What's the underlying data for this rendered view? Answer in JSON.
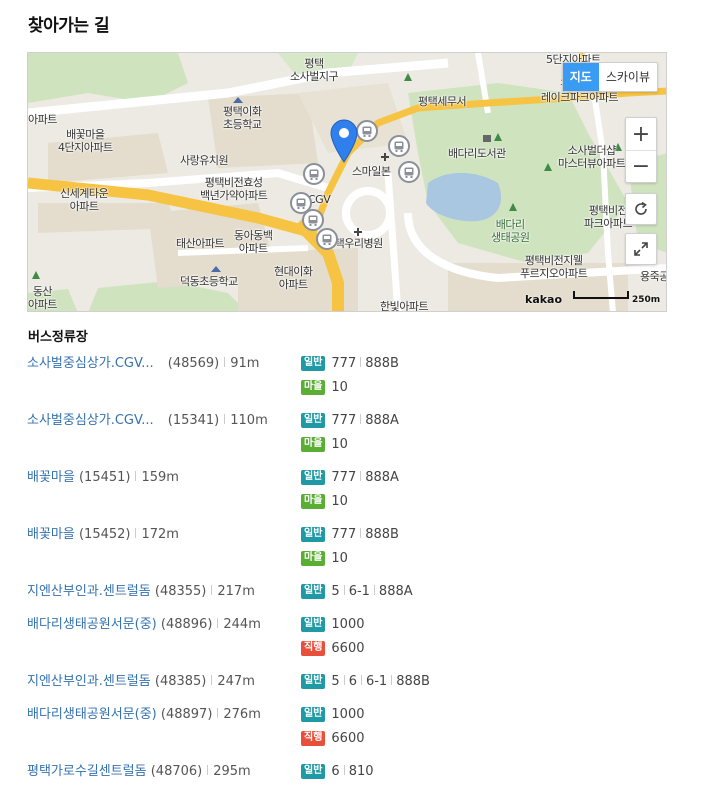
{
  "section_title": "찾아가는 길",
  "map": {
    "type_buttons": {
      "map": "지도",
      "skyview": "스카이뷰"
    },
    "controls": {
      "zoom_in": "+",
      "zoom_out": "−"
    },
    "brand": "kakao",
    "scale": "250m",
    "labels": {
      "police": "평택\n소사벌지구",
      "jugong_5": "5단지아파트",
      "tax_office": "평택세무서",
      "lake_park": "평택비전\n레이크파크아파트",
      "elementary_top": "평택이화\n초등학교",
      "apt_left": "아파트",
      "baekkot_4": "배꽃마을\n4단지아파트",
      "library": "배다리도서관",
      "sorasa_masters": "소사벌더샵\n마스터뷰아파트",
      "kindergarten": "사랑유치원",
      "smile_center": "스마일본",
      "hyosung": "평택비전효성\n백년가약아파트",
      "shinsegae": "신세계타운\n아파트",
      "cgv": "CGV",
      "vision_park": "평택비전\n파크아파트",
      "taesan": "태산아파트",
      "dongah": "동아동백\n아파트",
      "woori_hospital": "평택우리병원",
      "baedari_park": "배다리\n생태공원",
      "deokdong_school": "덕동초등학교",
      "hyundai": "현대이화\n아파트",
      "vision_well": "평택비전지웰\n푸르지오아파트",
      "dongsan": "동산\n아파트",
      "hanbit": "한빛아파트",
      "yongjuk": "용죽공"
    }
  },
  "bus_stops_title": "버스정류장",
  "bus_stops": [
    {
      "name": "소사벌중심상가.CGV...",
      "id": "(48569)",
      "dist": "91m",
      "lines": [
        {
          "type": "일반",
          "kind": "general",
          "routes": [
            "777",
            "888B"
          ]
        },
        {
          "type": "마을",
          "kind": "village",
          "routes": [
            "10"
          ]
        }
      ]
    },
    {
      "name": "소사벌중심상가.CGV...",
      "id": "(15341)",
      "dist": "110m",
      "lines": [
        {
          "type": "일반",
          "kind": "general",
          "routes": [
            "777",
            "888A"
          ]
        },
        {
          "type": "마을",
          "kind": "village",
          "routes": [
            "10"
          ]
        }
      ]
    },
    {
      "name": "배꽃마을",
      "id": "(15451)",
      "dist": "159m",
      "lines": [
        {
          "type": "일반",
          "kind": "general",
          "routes": [
            "777",
            "888A"
          ]
        },
        {
          "type": "마을",
          "kind": "village",
          "routes": [
            "10"
          ]
        }
      ]
    },
    {
      "name": "배꽃마을",
      "id": "(15452)",
      "dist": "172m",
      "lines": [
        {
          "type": "일반",
          "kind": "general",
          "routes": [
            "777",
            "888B"
          ]
        },
        {
          "type": "마을",
          "kind": "village",
          "routes": [
            "10"
          ]
        }
      ]
    },
    {
      "name": "지엔산부인과.센트럴돔",
      "id": "(48355)",
      "dist": "217m",
      "lines": [
        {
          "type": "일반",
          "kind": "general",
          "routes": [
            "5",
            "6-1",
            "888A"
          ]
        }
      ]
    },
    {
      "name": "배다리생태공원서문(중)",
      "id": "(48896)",
      "dist": "244m",
      "lines": [
        {
          "type": "일반",
          "kind": "general",
          "routes": [
            "1000"
          ]
        },
        {
          "type": "직행",
          "kind": "express",
          "routes": [
            "6600"
          ]
        }
      ]
    },
    {
      "name": "지엔산부인과.센트럴돔",
      "id": "(48385)",
      "dist": "247m",
      "lines": [
        {
          "type": "일반",
          "kind": "general",
          "routes": [
            "5",
            "6",
            "6-1",
            "888B"
          ]
        }
      ]
    },
    {
      "name": "배다리생태공원서문(중)",
      "id": "(48897)",
      "dist": "276m",
      "lines": [
        {
          "type": "일반",
          "kind": "general",
          "routes": [
            "1000"
          ]
        },
        {
          "type": "직행",
          "kind": "express",
          "routes": [
            "6600"
          ]
        }
      ]
    },
    {
      "name": "평택가로수길센트럴돔",
      "id": "(48706)",
      "dist": "295m",
      "lines": [
        {
          "type": "일반",
          "kind": "general",
          "routes": [
            "6",
            "810"
          ]
        }
      ]
    }
  ]
}
